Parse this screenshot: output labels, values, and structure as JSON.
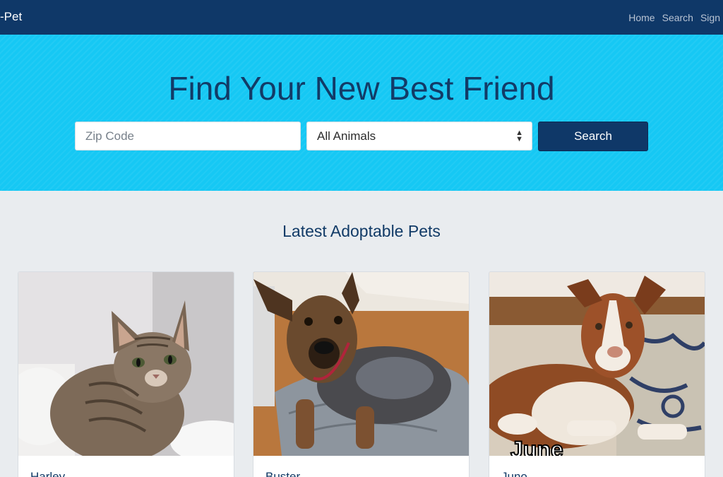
{
  "navbar": {
    "brand": "-Pet",
    "links": [
      "Home",
      "Search",
      "Sign"
    ]
  },
  "hero": {
    "title": "Find Your New Best Friend",
    "zip_placeholder": "Zip Code",
    "animal_select_value": "All Animals",
    "search_button": "Search"
  },
  "pets_section": {
    "title": "Latest Adoptable Pets",
    "pets": [
      {
        "name": "Harley",
        "photo_icon": "tabby-kitten-photo"
      },
      {
        "name": "Buster",
        "photo_icon": "heeler-puppy-photo"
      },
      {
        "name": "Juno",
        "photo_icon": "husky-dog-photo",
        "photo_caption": "June"
      }
    ]
  },
  "colors": {
    "navbar": "#0f3868",
    "hero": "#16c8f4",
    "title_text": "#123b67",
    "page_background": "#e9ecef"
  }
}
